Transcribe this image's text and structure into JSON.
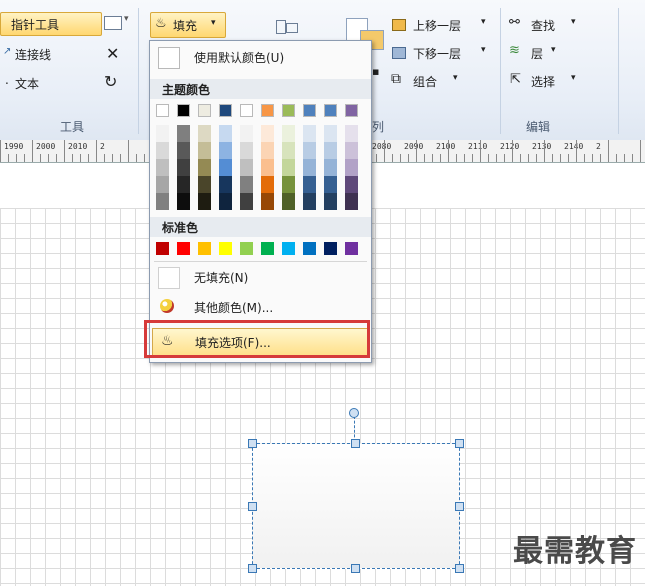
{
  "ribbon": {
    "tools": {
      "pointer_tool": "指针工具",
      "connector": "连接线",
      "text": "文本",
      "group_label": "工具"
    },
    "fill_button": "填充",
    "arrange": {
      "bring_forward": "上移一层",
      "send_backward": "下移一层",
      "group": "组合",
      "group_label_fragment": "列"
    },
    "editing": {
      "find": "查找",
      "layers": "层",
      "select": "选择",
      "group_label": "编辑"
    }
  },
  "ruler": {
    "labels": [
      "1990",
      "2000",
      "2010",
      "2",
      "2080",
      "2090",
      "2100",
      "2110",
      "2120",
      "2130",
      "2140",
      "2"
    ]
  },
  "fill_menu": {
    "use_default": "使用默认颜色(U)",
    "theme_colors_title": "主题颜色",
    "theme_top_row": [
      "#ffffff",
      "#000000",
      "#eeece1",
      "#1f497d",
      "#ffffff",
      "#f79646",
      "#9bbb59",
      "#4f81bd",
      "#4f81bd",
      "#8064a2"
    ],
    "theme_columns": [
      [
        "#f2f2f2",
        "#d9d9d9",
        "#bfbfbf",
        "#a6a6a6",
        "#808080"
      ],
      [
        "#7f7f7f",
        "#595959",
        "#404040",
        "#262626",
        "#0d0d0d"
      ],
      [
        "#ddd9c3",
        "#c4bd97",
        "#948a54",
        "#4a452a",
        "#1e1c11"
      ],
      [
        "#c6d9f0",
        "#8db3e2",
        "#548dd4",
        "#17365d",
        "#0f243e"
      ],
      [
        "#f2f2f2",
        "#d9d9d9",
        "#bfbfbf",
        "#808080",
        "#404040"
      ],
      [
        "#fde9d9",
        "#fbd4b4",
        "#fabf8f",
        "#e36c09",
        "#974806"
      ],
      [
        "#ebf1dd",
        "#d7e3bc",
        "#c3d69b",
        "#76923c",
        "#4f6128"
      ],
      [
        "#dbe5f1",
        "#b8cce4",
        "#95b3d7",
        "#366092",
        "#244061"
      ],
      [
        "#dbe5f1",
        "#b8cce4",
        "#95b3d7",
        "#366092",
        "#244061"
      ],
      [
        "#e5e0ec",
        "#ccc1d9",
        "#b2a2c7",
        "#5f497a",
        "#3f3151"
      ]
    ],
    "standard_colors_title": "标准色",
    "standard_colors": [
      "#c00000",
      "#ff0000",
      "#ffc000",
      "#ffff00",
      "#92d050",
      "#00b050",
      "#00b0f0",
      "#0070c0",
      "#002060",
      "#7030a0"
    ],
    "no_fill": "无填充(N)",
    "more_colors": "其他颜色(M)...",
    "fill_options": "填充选项(F)..."
  },
  "highlight_color": "#d63a3a",
  "accent_color": "#ffd770",
  "watermark": "最需教育"
}
